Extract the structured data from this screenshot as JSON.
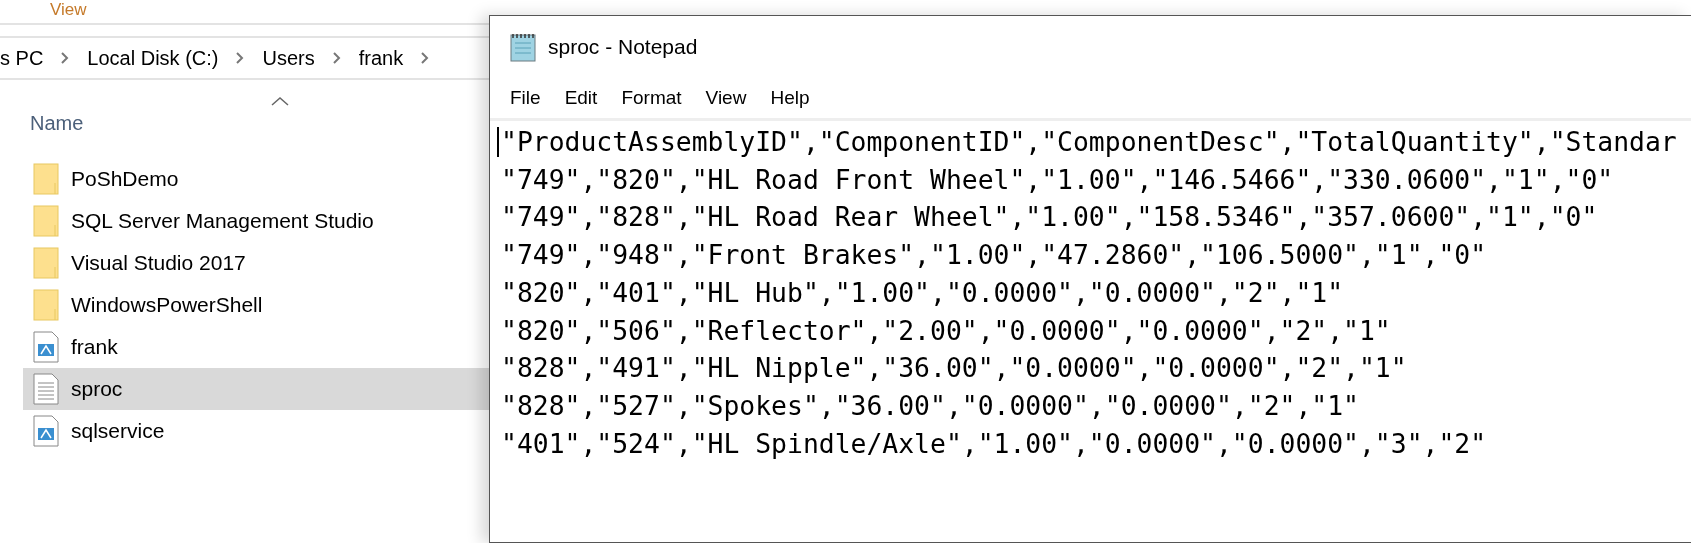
{
  "explorer": {
    "ribbon_tab": "View",
    "breadcrumb": [
      "s PC",
      "Local Disk (C:)",
      "Users",
      "frank"
    ],
    "column_header": "Name",
    "items": [
      {
        "name": "PoShDemo",
        "kind": "folder",
        "selected": false
      },
      {
        "name": "SQL Server Management Studio",
        "kind": "folder",
        "selected": false
      },
      {
        "name": "Visual Studio 2017",
        "kind": "folder",
        "selected": false
      },
      {
        "name": "WindowsPowerShell",
        "kind": "folder",
        "selected": false
      },
      {
        "name": "frank",
        "kind": "script",
        "selected": false
      },
      {
        "name": "sproc",
        "kind": "text",
        "selected": true
      },
      {
        "name": "sqlservice",
        "kind": "script",
        "selected": false
      }
    ]
  },
  "notepad": {
    "title": "sproc - Notepad",
    "menu": [
      "File",
      "Edit",
      "Format",
      "View",
      "Help"
    ],
    "lines": [
      "\"ProductAssemblyID\",\"ComponentID\",\"ComponentDesc\",\"TotalQuantity\",\"Standar",
      "\"749\",\"820\",\"HL Road Front Wheel\",\"1.00\",\"146.5466\",\"330.0600\",\"1\",\"0\"",
      "\"749\",\"828\",\"HL Road Rear Wheel\",\"1.00\",\"158.5346\",\"357.0600\",\"1\",\"0\"",
      "\"749\",\"948\",\"Front Brakes\",\"1.00\",\"47.2860\",\"106.5000\",\"1\",\"0\"",
      "\"820\",\"401\",\"HL Hub\",\"1.00\",\"0.0000\",\"0.0000\",\"2\",\"1\"",
      "\"820\",\"506\",\"Reflector\",\"2.00\",\"0.0000\",\"0.0000\",\"2\",\"1\"",
      "\"828\",\"491\",\"HL Nipple\",\"36.00\",\"0.0000\",\"0.0000\",\"2\",\"1\"",
      "\"828\",\"527\",\"Spokes\",\"36.00\",\"0.0000\",\"0.0000\",\"2\",\"1\"",
      "\"401\",\"524\",\"HL Spindle/Axle\",\"1.00\",\"0.0000\",\"0.0000\",\"3\",\"2\""
    ]
  }
}
